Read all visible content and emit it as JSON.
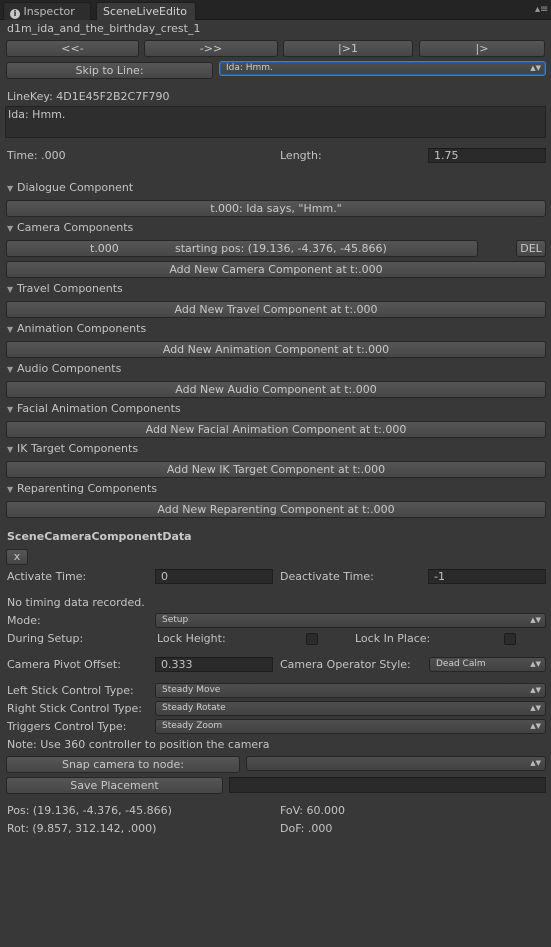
{
  "tabs": {
    "inspector": "Inspector",
    "scene_live": "SceneLiveEdito"
  },
  "node_title": "d1m_ida_and_the_birthday_crest_1",
  "nav": {
    "prev": "<<-",
    "next": "->>",
    "first": "|>1",
    "last": "|>"
  },
  "skip_to_line": {
    "label": "Skip to Line:",
    "selected": "Ida: Hmm."
  },
  "line_key": "LineKey: 4D1E45F2B2C7F790",
  "dialogue_text": "Ida: Hmm.",
  "time": {
    "label": "Time: .000",
    "length_label": "Length:",
    "length_value": "1.75"
  },
  "sections": {
    "dialogue": {
      "title": "Dialogue Component",
      "button": "t.000: Ida says, \"Hmm.\""
    },
    "camera": {
      "title": "Camera Components",
      "item_time": "t.000",
      "item_pos": "starting pos: (19.136, -4.376, -45.866)",
      "del": "DEL",
      "add": "Add New Camera Component at t:.000"
    },
    "travel": {
      "title": "Travel Components",
      "add": "Add New Travel Component at t:.000"
    },
    "animation": {
      "title": "Animation Components",
      "add": "Add New Animation Component at t:.000"
    },
    "audio": {
      "title": "Audio Components",
      "add": "Add New Audio Component at t:.000"
    },
    "facial": {
      "title": "Facial Animation Components",
      "add": "Add New Facial Animation Component at t:.000"
    },
    "ik": {
      "title": "IK Target Components",
      "add": "Add New IK Target Component at t:.000"
    },
    "reparent": {
      "title": "Reparenting Components",
      "add": "Add New Reparenting Component at t:.000"
    }
  },
  "camera_data": {
    "header": "SceneCameraComponentData",
    "close": "x",
    "activate_label": "Activate Time:",
    "activate_value": "0",
    "deactivate_label": "Deactivate Time:",
    "deactivate_value": "-1",
    "timing_note": "No timing data recorded.",
    "mode_label": "Mode:",
    "mode_value": "Setup",
    "during_setup_label": "During Setup:",
    "lock_height_label": "Lock Height:",
    "lock_in_place_label": "Lock In Place:",
    "pivot_label": "Camera Pivot Offset:",
    "pivot_value": "0.333",
    "operator_label": "Camera Operator Style:",
    "operator_value": "Dead Calm",
    "left_stick_label": "Left Stick Control Type:",
    "left_stick_value": "Steady Move",
    "right_stick_label": "Right Stick Control Type:",
    "right_stick_value": "Steady Rotate",
    "triggers_label": "Triggers Control Type:",
    "triggers_value": "Steady Zoom",
    "note": "Note: Use 360 controller to position the camera",
    "snap_button": "Snap camera to node:",
    "snap_value": "",
    "save_button": "Save Placement",
    "save_field": "",
    "pos": "Pos: (19.136, -4.376, -45.866)",
    "fov": "FoV: 60.000",
    "rot": "Rot: (9.857, 312.142, .000)",
    "dof": "DoF: .000"
  }
}
